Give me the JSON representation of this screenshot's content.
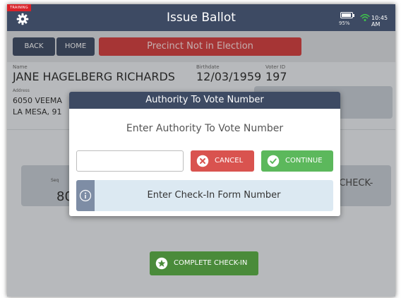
{
  "status_bar": {
    "training_label": "TRAINING",
    "title": "Issue Ballot",
    "battery_percent": "95%",
    "battery_level": 0.95,
    "time": "10:45 AM"
  },
  "toolbar": {
    "back_label": "BACK",
    "home_label": "HOME",
    "precinct_status": "Precinct Not in Election"
  },
  "voter": {
    "name_label": "Name",
    "name": "JANE HAGELBERG RICHARDS",
    "birthdate_label": "Birthdate",
    "birthdate": "12/03/1959",
    "voter_id_label": "Voter ID",
    "voter_id": "197",
    "address_label": "Address",
    "address_line1": "6050 VEEMA",
    "address_line2": "LA MESA, 91"
  },
  "main": {
    "seq_label": "Seq",
    "seq_value": "80",
    "check_text": "E CHECK-",
    "complete_label": "COMPLETE CHECK-IN"
  },
  "modal": {
    "title": "Authority To Vote Number",
    "prompt": "Enter Authority To Vote Number",
    "input_value": "",
    "cancel_label": "CANCEL",
    "continue_label": "CONTINUE",
    "hint": "Enter Check-In Form Number"
  },
  "icons": {
    "settings": "gear-icon",
    "battery": "battery-icon",
    "wifi": "wifi-icon",
    "cancel": "x-circle-icon",
    "continue": "check-circle-icon",
    "info": "info-icon",
    "complete": "star-icon"
  },
  "colors": {
    "header": "#3d4a63",
    "danger": "#d9534f",
    "success": "#5cb85c",
    "complete": "#4a8b3a",
    "precinct_alert": "#d33c3c",
    "wifi": "#3ec84a"
  }
}
